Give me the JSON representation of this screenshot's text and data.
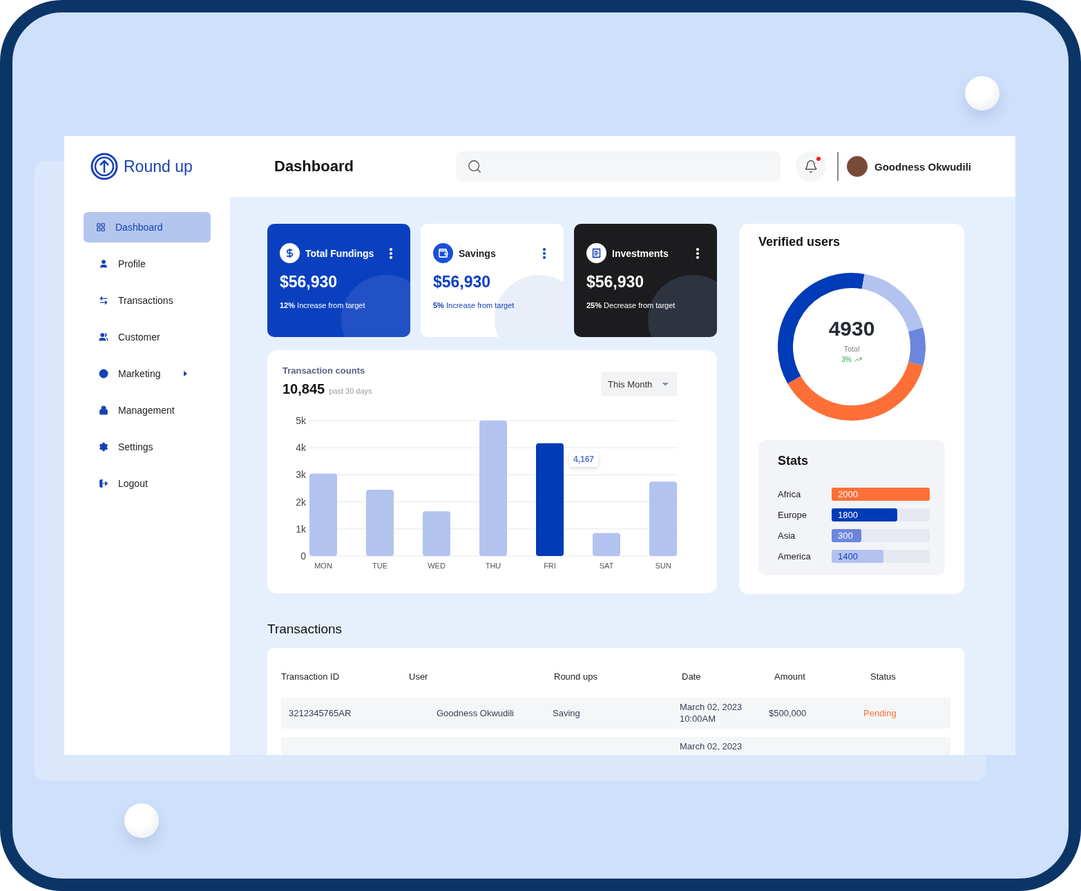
{
  "brand": {
    "name": "Round up"
  },
  "header": {
    "title": "Dashboard",
    "user_name": "Goodness Okwudili",
    "notification": true
  },
  "sidebar": {
    "items": [
      {
        "label": "Dashboard",
        "kind": "grid",
        "selected": true
      },
      {
        "label": "Profile",
        "kind": "user",
        "selected": false
      },
      {
        "label": "Transactions",
        "kind": "exchange",
        "selected": false
      },
      {
        "label": "Customer",
        "kind": "users",
        "selected": false
      },
      {
        "label": "Marketing",
        "kind": "globe",
        "selected": false,
        "submenu": true
      },
      {
        "label": "Management",
        "kind": "lock",
        "selected": false
      },
      {
        "label": "Settings",
        "kind": "gear",
        "selected": false
      },
      {
        "label": "Logout",
        "kind": "logout",
        "selected": false
      }
    ]
  },
  "summary_cards": [
    {
      "kind": "blue",
      "title": "Total Fundings",
      "amount": "$56,930",
      "note": "**12%** Increase from target"
    },
    {
      "kind": "white",
      "title": "Savings",
      "amount": "$56,930",
      "note": "**5%** Increase from target"
    },
    {
      "kind": "dark",
      "title": "Investments",
      "amount": "$56,930",
      "note": "**25%** Decrease from target"
    }
  ],
  "transaction_counts": {
    "title": "Transaction counts",
    "total": "10,845",
    "period": "past 30 days",
    "filter": "This Month",
    "chart_data": {
      "type": "bar",
      "categories": [
        "MON",
        "TUE",
        "WED",
        "THU",
        "FRI",
        "SAT",
        "SUN"
      ],
      "series": [
        {
          "color": "#b3c3f0",
          "values": [
            3050,
            2450,
            1650,
            5000,
            null,
            850,
            2750
          ]
        },
        {
          "color": "#003bb8",
          "values": [
            null,
            null,
            null,
            null,
            4167,
            null,
            null
          ]
        }
      ],
      "stacked": true,
      "grid": true,
      "ylim": [
        0,
        5000
      ],
      "yticks": [
        {
          "value": 0,
          "label": "0"
        },
        {
          "value": 1000,
          "label": "1k"
        },
        {
          "value": 2000,
          "label": "2k"
        },
        {
          "value": 3000,
          "label": "3k"
        },
        {
          "value": 4000,
          "label": "4k"
        },
        {
          "value": 5000,
          "label": "5k"
        }
      ],
      "annotations": [
        "4,167"
      ]
    }
  },
  "verified_users": {
    "title": "Verified users",
    "total": "4930",
    "total_label": "Total",
    "change": "3%",
    "stats_title": "Stats",
    "stats": [
      {
        "region": "Africa",
        "value": "2000",
        "color": "#fe6f37",
        "level": 1.0
      },
      {
        "region": "Europe",
        "value": "1800",
        "color": "#003bb8",
        "level": 0.67
      },
      {
        "region": "Asia",
        "value": "300",
        "color": "#6b86dc",
        "level": 0.3
      },
      {
        "region": "America",
        "value": "1400",
        "color": "#b3c3f0",
        "level": 0.53
      }
    ]
  },
  "transactions": {
    "title": "Transactions",
    "columns": [
      "Transaction ID",
      "User",
      "Round ups",
      "Date",
      "Amount",
      "Status"
    ],
    "rows": [
      {
        "id": "3212345765AR",
        "user": "Goodness Okwudili",
        "round_ups": "Saving",
        "date": "March 02, 2023",
        "time": "10:00AM",
        "amount": "$500,000",
        "status": "Pending"
      },
      {
        "date": "March 02, 2023"
      }
    ]
  }
}
